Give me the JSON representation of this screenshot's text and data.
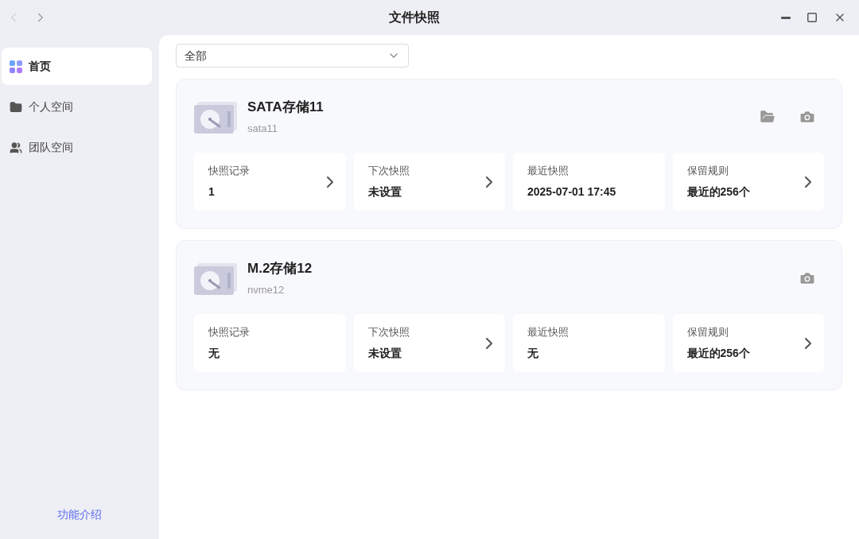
{
  "window": {
    "title": "文件快照"
  },
  "nav": [
    {
      "kind": "back",
      "disabled": true
    },
    {
      "kind": "forward",
      "disabled": false
    }
  ],
  "sidebar": {
    "items": [
      {
        "label": "首页",
        "kind": "home",
        "selected": true
      },
      {
        "label": "个人空间",
        "kind": "folder",
        "selected": false
      },
      {
        "label": "团队空间",
        "kind": "team",
        "selected": false
      }
    ],
    "footer_link": "功能介绍"
  },
  "filter": {
    "value": "全部"
  },
  "storages": [
    {
      "name": "SATA存储11",
      "id": "sata11",
      "actions": [
        {
          "kind": "folder"
        },
        {
          "kind": "camera"
        }
      ],
      "stats": [
        {
          "label": "快照记录",
          "value": "1",
          "arrow": true
        },
        {
          "label": "下次快照",
          "value": "未设置",
          "arrow": true
        },
        {
          "label": "最近快照",
          "value": "2025-07-01 17:45",
          "arrow": false
        },
        {
          "label": "保留规则",
          "value": "最近的256个",
          "arrow": true
        }
      ]
    },
    {
      "name": "M.2存储12",
      "id": "nvme12",
      "actions": [
        {
          "kind": "camera"
        }
      ],
      "stats": [
        {
          "label": "快照记录",
          "value": "无",
          "arrow": false
        },
        {
          "label": "下次快照",
          "value": "未设置",
          "arrow": true
        },
        {
          "label": "最近快照",
          "value": "无",
          "arrow": false
        },
        {
          "label": "保留规则",
          "value": "最近的256个",
          "arrow": true
        }
      ]
    }
  ]
}
